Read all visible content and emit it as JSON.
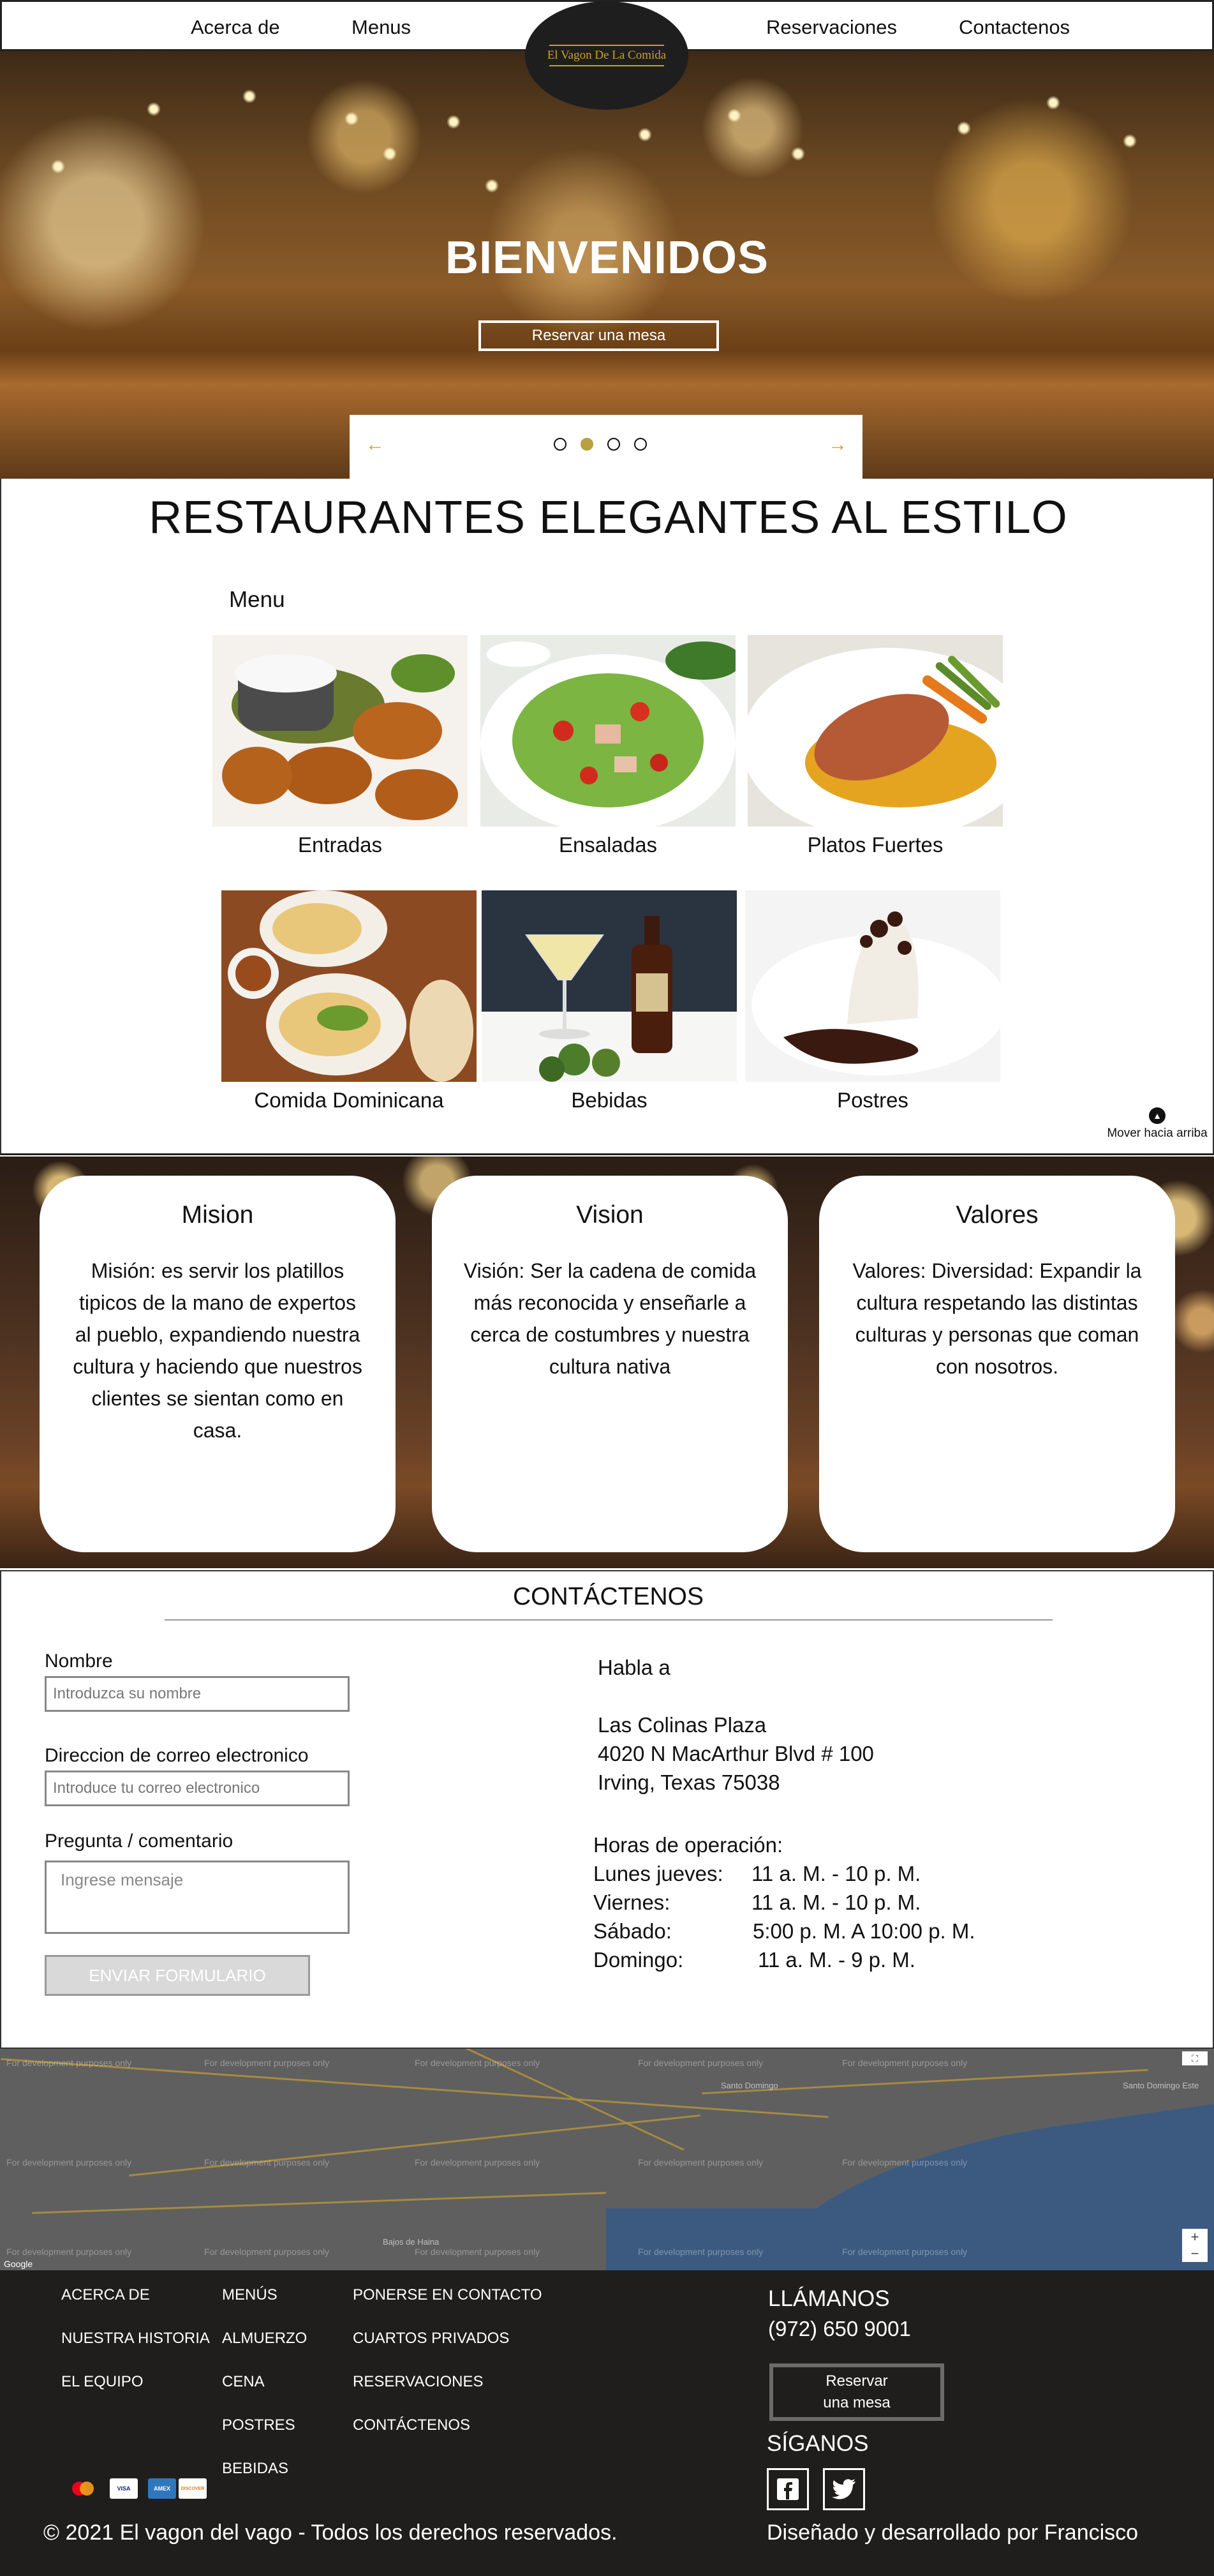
{
  "nav": {
    "about": "Acerca de",
    "menus": "Menus",
    "logo_text": "El Vagon De La Comida",
    "reservations": "Reservaciones",
    "contact": "Contactenos"
  },
  "hero": {
    "title": "BIENVENIDOS",
    "button": "Reservar una mesa",
    "prev_arrow": "←",
    "next_arrow": "→",
    "active_slide": 2,
    "slide_count": 4
  },
  "menu": {
    "title": "RESTAURANTES ELEGANTES AL ESTILO",
    "label": "Menu",
    "items": [
      {
        "caption": "Entradas"
      },
      {
        "caption": "Ensaladas"
      },
      {
        "caption": "Platos Fuertes"
      },
      {
        "caption": "Comida Dominicana"
      },
      {
        "caption": "Bebidas"
      },
      {
        "caption": "Postres"
      }
    ],
    "scroll_top": "Mover hacia arriba"
  },
  "values": {
    "cards": [
      {
        "title": "Mision",
        "text": "Misión: es servir los platillos tipicos de la mano de expertos al pueblo, expandiendo nuestra cultura y haciendo que nuestros clientes se sientan como en casa."
      },
      {
        "title": "Vision",
        "text": "Visión: Ser la cadena de comida más reconocida  y enseñarle a cerca de costumbres y nuestra cultura nativa"
      },
      {
        "title": "Valores",
        "text": "Valores: Diversidad: Expandir la cultura respetando las distintas culturas y personas que coman con nosotros."
      }
    ]
  },
  "contact": {
    "title": "CONTÁCTENOS",
    "name_label": "Nombre",
    "name_placeholder": "Introduzca su nombre",
    "email_label": "Direccion de correo electronico",
    "email_placeholder": "Introduce tu correo electronico",
    "comment_label": "Pregunta / comentario",
    "comment_placeholder": "Ingrese mensaje",
    "submit": "ENVIAR FORMULARIO",
    "talk_to": "Habla a",
    "address": [
      "Las Colinas Plaza",
      "4020 N MacArthur Blvd # 100",
      "Irving, Texas 75038"
    ],
    "hours_title": "Horas de operación:",
    "hours": [
      {
        "day": "Lunes jueves:",
        "time": "11 a. M. - 10 p. M."
      },
      {
        "day": "Viernes:",
        "time": "11 a. M. - 10 p. M."
      },
      {
        "day": "Sábado:",
        "time": "5:00 p. M. A 10:00 p. M."
      },
      {
        "day": "Domingo:",
        "time": "11 a. M. - 9 p. M."
      }
    ]
  },
  "map": {
    "watermark": "For development purposes only",
    "google": "Google",
    "places": [
      "Santo Domingo",
      "Santo Domingo Este",
      "Bajos de Haina"
    ],
    "zoom_in": "+",
    "zoom_out": "−"
  },
  "footer": {
    "col1": [
      "ACERCA DE",
      "NUESTRA HISTORIA",
      "EL EQUIPO"
    ],
    "col2": [
      "MENÚS",
      "ALMUERZO",
      "CENA",
      "POSTRES",
      "BEBIDAS"
    ],
    "col3": [
      "PONERSE EN CONTACTO",
      "CUARTOS PRIVADOS",
      "RESERVACIONES",
      "CONTÁCTENOS"
    ],
    "call_title": "LLÁMANOS",
    "phone": "(972) 650 9001",
    "reserve_line1": "Reservar",
    "reserve_line2": "una mesa",
    "follow": "SÍGANOS",
    "payments": [
      "mastercard",
      "VISA",
      "AMEX",
      "DISCOVER"
    ],
    "copyright": "© 2021 El vagon del vago - Todos los derechos reservados.",
    "credit": "Diseñado y desarrollado por Francisco"
  }
}
